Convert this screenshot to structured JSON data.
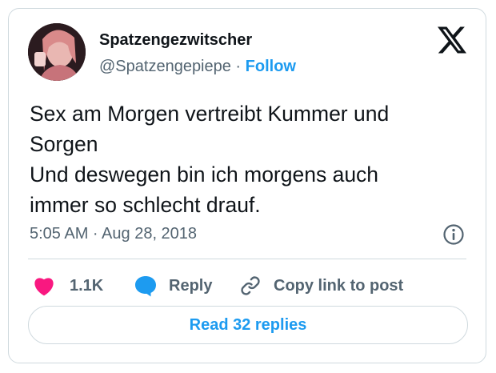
{
  "author": {
    "display_name": "Spatzengezwitscher",
    "handle": "@Spatzengepiepe",
    "separator": " · ",
    "follow_label": "Follow"
  },
  "tweet": {
    "lines": [
      "Sex am Morgen vertreibt Kummer und",
      "Sorgen",
      "Und deswegen bin ich morgens auch",
      "immer so schlecht drauf."
    ],
    "timestamp": "5:05 AM · Aug 28, 2018"
  },
  "actions": {
    "like_count": "1.1K",
    "reply_label": "Reply",
    "copy_link_label": "Copy link to post"
  },
  "replies_button_label": "Read 32 replies",
  "colors": {
    "accent": "#1d9bf0",
    "like": "#f91880",
    "secondary_text": "#536471",
    "border": "#cfd9de"
  },
  "icons": [
    "x-logo-icon",
    "info-icon",
    "heart-icon",
    "reply-bubble-icon",
    "link-icon"
  ]
}
